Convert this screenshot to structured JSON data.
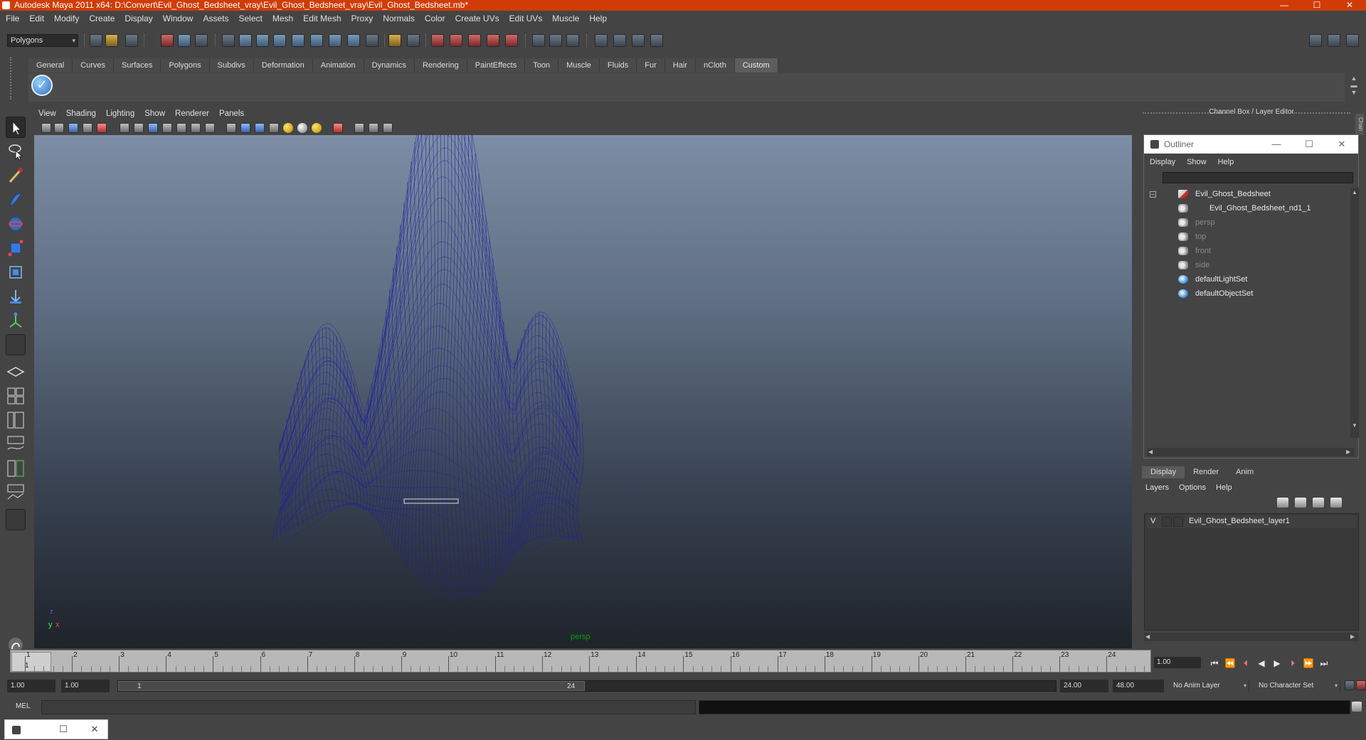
{
  "window": {
    "title": "Autodesk Maya 2011 x64: D:\\Convert\\Evil_Ghost_Bedsheet_vray\\Evil_Ghost_Bedsheet_vray\\Evil_Ghost_Bedsheet.mb*",
    "minimize": "—",
    "maximize": "☐",
    "close": "✕"
  },
  "menubar": [
    "File",
    "Edit",
    "Modify",
    "Create",
    "Display",
    "Window",
    "Assets",
    "Select",
    "Mesh",
    "Edit Mesh",
    "Proxy",
    "Normals",
    "Color",
    "Create UVs",
    "Edit UVs",
    "Muscle",
    "Help"
  ],
  "statusline": {
    "mode": "Polygons",
    "mode_arrow": "▾"
  },
  "shelf": {
    "tabs": [
      "General",
      "Curves",
      "Surfaces",
      "Polygons",
      "Subdivs",
      "Deformation",
      "Animation",
      "Dynamics",
      "Rendering",
      "PaintEffects",
      "Toon",
      "Muscle",
      "Fluids",
      "Fur",
      "Hair",
      "nCloth",
      "Custom"
    ],
    "active_tab": "Custom",
    "icon_glyph": "✓",
    "scroll_up": "▲",
    "scroll_mid": "▬",
    "scroll_down": "▼"
  },
  "viewport": {
    "menu": [
      "View",
      "Shading",
      "Lighting",
      "Show",
      "Renderer",
      "Panels"
    ],
    "camera": "persp",
    "axes": {
      "y": "y",
      "x": "x",
      "z": "z"
    },
    "wire_color": "#1f1fa0"
  },
  "channel_box": {
    "title": "Channel Box / Layer Editor",
    "side_tab": "Chan"
  },
  "outliner": {
    "title": "Outliner",
    "minimize": "—",
    "maximize": "☐",
    "close": "✕",
    "menu": [
      "Display",
      "Show",
      "Help"
    ],
    "collapse_glyph": "–",
    "items": [
      {
        "label": "Evil_Ghost_Bedsheet",
        "icon": "mesh-icon",
        "dim": false
      },
      {
        "label": "Evil_Ghost_Bedsheet_nd1_1",
        "icon": "camera-icon",
        "dim": false
      },
      {
        "label": "persp",
        "icon": "camera-icon",
        "dim": true
      },
      {
        "label": "top",
        "icon": "camera-icon",
        "dim": true
      },
      {
        "label": "front",
        "icon": "camera-icon",
        "dim": true
      },
      {
        "label": "side",
        "icon": "camera-icon",
        "dim": true
      },
      {
        "label": "defaultLightSet",
        "icon": "set-icon",
        "dim": false
      },
      {
        "label": "defaultObjectSet",
        "icon": "set-icon",
        "dim": false
      }
    ],
    "arrows": {
      "up": "▲",
      "down": "▼",
      "left": "◀",
      "right": "▶"
    }
  },
  "layer_editor": {
    "tabs": [
      "Display",
      "Render",
      "Anim"
    ],
    "active_tab": "Display",
    "menu": [
      "Layers",
      "Options",
      "Help"
    ],
    "layer": {
      "visible": "V",
      "name": "Evil_Ghost_Bedsheet_layer1"
    }
  },
  "timeline": {
    "ticks": [
      "1",
      "2",
      "3",
      "4",
      "5",
      "6",
      "7",
      "8",
      "9",
      "10",
      "11",
      "12",
      "13",
      "14",
      "15",
      "16",
      "17",
      "18",
      "19",
      "20",
      "21",
      "22",
      "23",
      "24"
    ],
    "current_frame": "1",
    "current_time": "1.00"
  },
  "playback": [
    "⏮",
    "⏪",
    "⏴",
    "◀",
    "▶",
    "⏵",
    "⏩",
    "⏭"
  ],
  "range": {
    "start_time": "1.00",
    "playback_start": "1.00",
    "slider_start": "1",
    "slider_end": "24",
    "playback_end": "24.00",
    "end_time": "48.00",
    "anim_layer": "No Anim Layer",
    "character_set": "No Character Set",
    "arrow": "▾"
  },
  "commandline": {
    "label": "MEL",
    "value": ""
  },
  "minimized_window": {
    "restore": "☐",
    "close": "✕"
  }
}
